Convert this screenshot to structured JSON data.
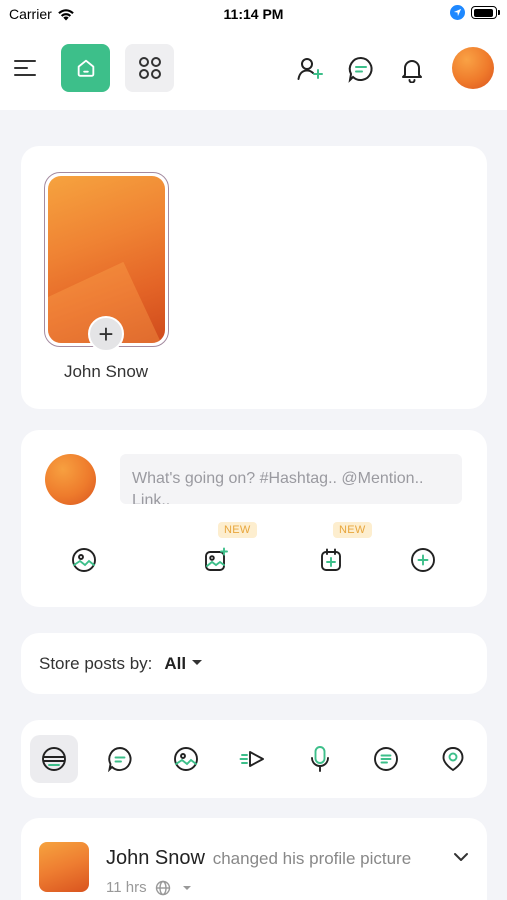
{
  "status_bar": {
    "carrier": "Carrier",
    "time": "11:14 PM",
    "battery_level": 0.95
  },
  "nav": {
    "icons": [
      "menu-icon",
      "home-icon",
      "apps-grid-icon",
      "add-user-icon",
      "chat-icon",
      "bell-icon"
    ],
    "accent_color": "#3dbf8a"
  },
  "story": {
    "name": "John Snow",
    "add_symbol": "+"
  },
  "composer": {
    "placeholder": "What's going on? #Hashtag.. @Mention.. Link..",
    "actions": [
      {
        "icon": "photo-icon",
        "badge": ""
      },
      {
        "icon": "image-add-icon",
        "badge": "NEW"
      },
      {
        "icon": "calendar-add-icon",
        "badge": "NEW"
      },
      {
        "icon": "plus-circle-icon",
        "badge": ""
      }
    ]
  },
  "filter": {
    "label": "Store posts by:",
    "value": "All"
  },
  "post_types": [
    {
      "icon": "text-post-icon",
      "active": true
    },
    {
      "icon": "chat-post-icon",
      "active": false
    },
    {
      "icon": "photo-post-icon",
      "active": false
    },
    {
      "icon": "video-post-icon",
      "active": false
    },
    {
      "icon": "microphone-icon",
      "active": false
    },
    {
      "icon": "document-icon",
      "active": false
    },
    {
      "icon": "location-icon",
      "active": false
    }
  ],
  "post": {
    "author": "John Snow",
    "action": "changed his profile picture",
    "time": "11 hrs",
    "visibility_icon": "globe-icon"
  }
}
